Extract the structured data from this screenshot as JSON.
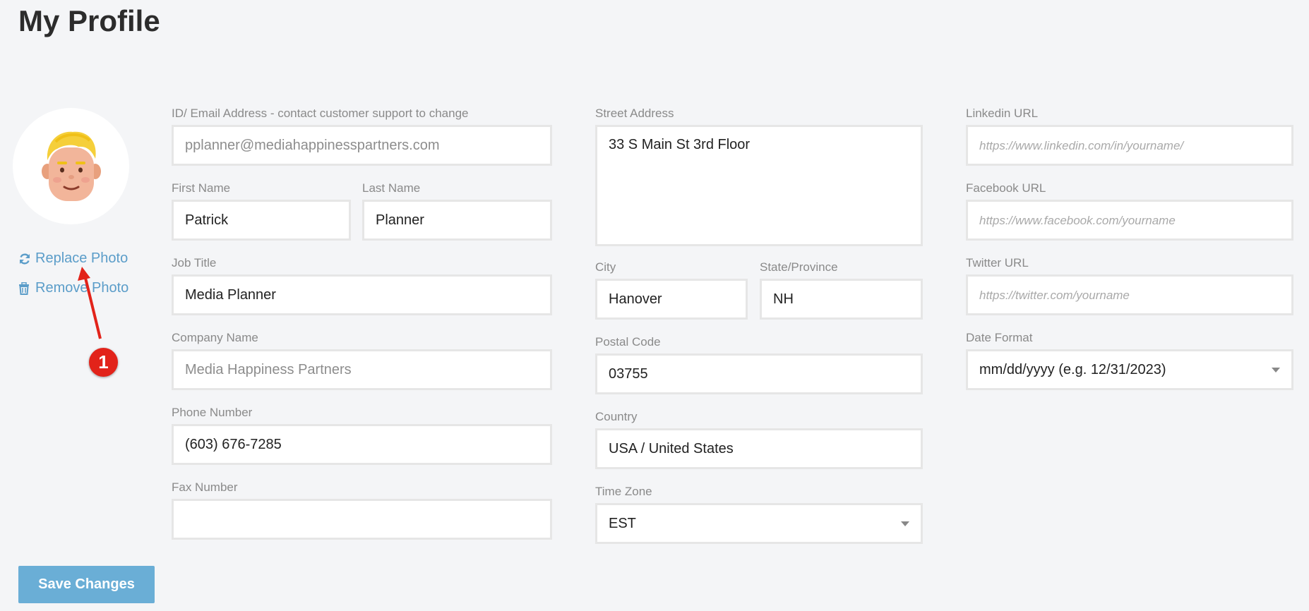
{
  "page": {
    "title": "My Profile"
  },
  "photo": {
    "replace_label": "Replace Photo",
    "remove_label": "Remove Photo",
    "replace_icon": "refresh-icon",
    "remove_icon": "trash-icon"
  },
  "annotation": {
    "number": "1",
    "color": "#e2231a"
  },
  "form": {
    "email": {
      "label": "ID/ Email Address - contact customer support to change",
      "value": "pplanner@mediahappinesspartners.com"
    },
    "first_name": {
      "label": "First Name",
      "value": "Patrick"
    },
    "last_name": {
      "label": "Last Name",
      "value": "Planner"
    },
    "job_title": {
      "label": "Job Title",
      "value": "Media Planner"
    },
    "company": {
      "label": "Company Name",
      "value": "Media Happiness Partners"
    },
    "phone": {
      "label": "Phone Number",
      "value": "(603) 676-7285"
    },
    "fax": {
      "label": "Fax Number",
      "value": ""
    },
    "street": {
      "label": "Street Address",
      "value": "33 S Main St 3rd Floor"
    },
    "city": {
      "label": "City",
      "value": "Hanover"
    },
    "state": {
      "label": "State/Province",
      "value": "NH"
    },
    "postal": {
      "label": "Postal Code",
      "value": "03755"
    },
    "country": {
      "label": "Country",
      "value": "USA / United States"
    },
    "timezone": {
      "label": "Time Zone",
      "value": "EST"
    },
    "linkedin": {
      "label": "Linkedin URL",
      "placeholder": "https://www.linkedin.com/in/yourname/"
    },
    "facebook": {
      "label": "Facebook URL",
      "placeholder": "https://www.facebook.com/yourname"
    },
    "twitter": {
      "label": "Twitter URL",
      "placeholder": "https://twitter.com/yourname"
    },
    "date_format": {
      "label": "Date Format",
      "value": "mm/dd/yyyy (e.g. 12/31/2023)"
    }
  },
  "actions": {
    "save_label": "Save Changes"
  },
  "colors": {
    "link": "#5b9dc9",
    "save_button": "#6aaed6",
    "background": "#f4f5f7"
  }
}
